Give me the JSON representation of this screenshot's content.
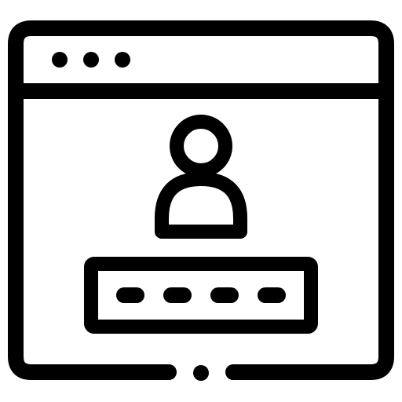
{
  "icon": {
    "name": "browser-login-icon",
    "stroke_color": "#000000",
    "background_color": "#ffffff"
  },
  "window": {
    "dots": [
      "dot-1",
      "dot-2",
      "dot-3"
    ]
  },
  "user": {
    "avatar_icon": "user-icon"
  },
  "password_field": {
    "masked_dots": 4
  }
}
